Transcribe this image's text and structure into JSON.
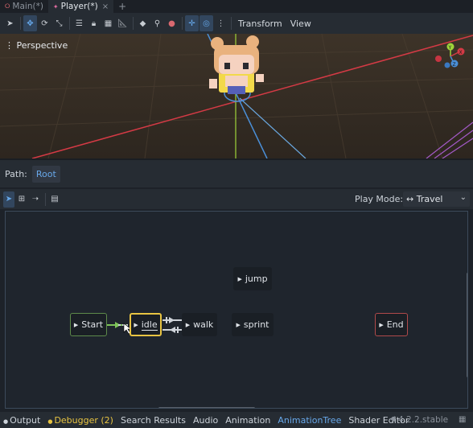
{
  "tabs": [
    {
      "label": "Main(*)",
      "active": false
    },
    {
      "label": "Player(*)",
      "active": true
    }
  ],
  "tab_add_glyph": "+",
  "tab_close_glyph": "×",
  "viewport_toolbar": {
    "transform_menu": "Transform",
    "view_menu": "View",
    "icons": [
      "select-icon",
      "move-icon",
      "rotate-icon",
      "scale-icon",
      "list-select-icon",
      "lock-icon",
      "group-icon",
      "ruler-icon",
      "object-icon",
      "bone-icon",
      "snap-icon",
      "local-space-icon",
      "grid-snap-icon",
      "more-icon"
    ]
  },
  "viewport": {
    "mode_label": "Perspective",
    "gizmo_axes": [
      "Y",
      "X",
      "Z"
    ]
  },
  "path_bar": {
    "label": "Path:",
    "root": "Root"
  },
  "state_machine_toolbar": {
    "play_mode_label": "Play Mode:",
    "play_mode_value": "↔ Travel"
  },
  "state_graph": {
    "nodes": [
      {
        "name": "Start",
        "kind": "start"
      },
      {
        "name": "idle",
        "kind": "current"
      },
      {
        "name": "walk",
        "kind": "normal"
      },
      {
        "name": "jump",
        "kind": "normal"
      },
      {
        "name": "sprint",
        "kind": "normal"
      },
      {
        "name": "End",
        "kind": "end"
      }
    ]
  },
  "bottom_panel": {
    "tabs": [
      "Output",
      "Debugger (2)",
      "Search Results",
      "Audio",
      "Animation",
      "AnimationTree",
      "Shader Editor"
    ],
    "active_tab": "AnimationTree",
    "version": "4.2.2.stable"
  },
  "colors": {
    "accent": "#68a8ea",
    "current_state_border": "#e8c442",
    "start_border": "#5d8a4a",
    "end_border": "#b04a4a",
    "transition_start": "#7ec45a"
  }
}
